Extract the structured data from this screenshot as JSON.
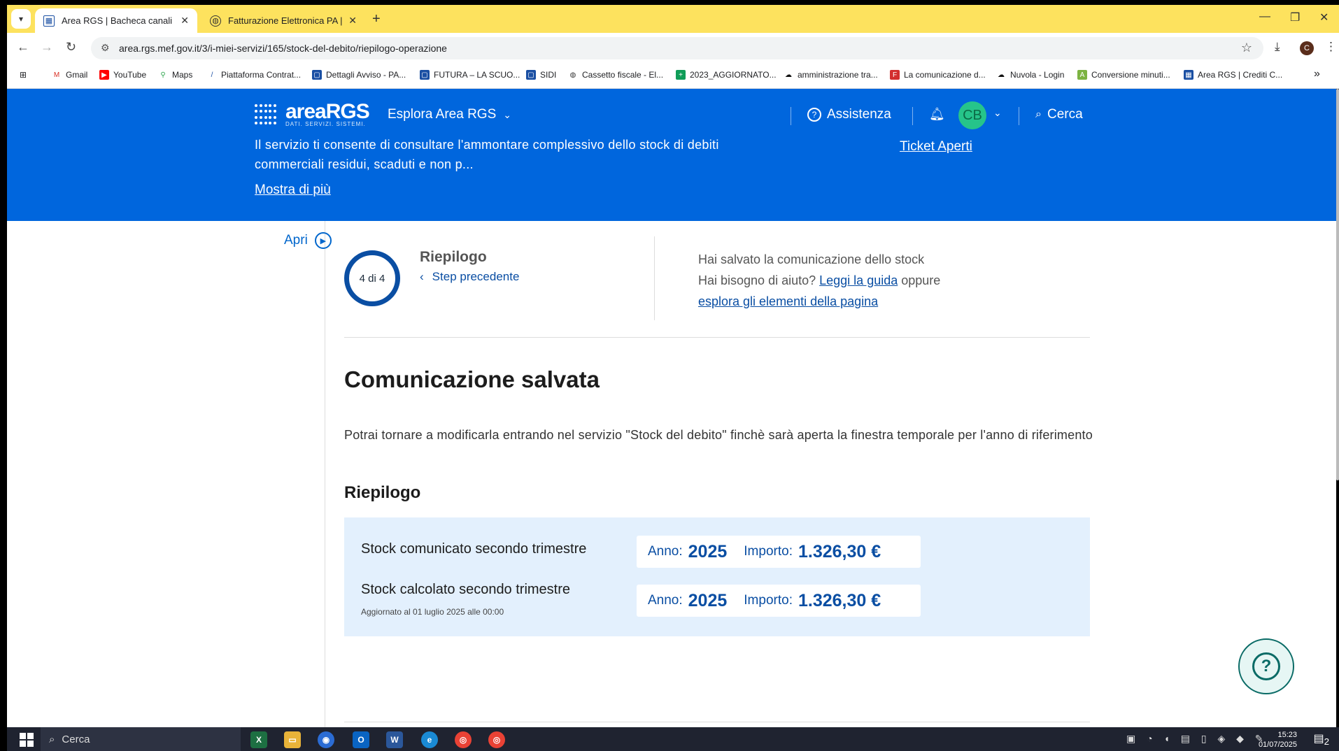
{
  "browser": {
    "tabs": [
      {
        "title": "Area RGS | Bacheca canali",
        "active": true
      },
      {
        "title": "Fatturazione Elettronica PA | Ge",
        "active": false
      }
    ],
    "new_tab": "+",
    "url": "area.rgs.mef.gov.it/3/i-miei-servizi/165/stock-del-debito/riepilogo-operazione",
    "profile_initial": "C",
    "bookmarks": [
      "Gmail",
      "YouTube",
      "Maps",
      "Piattaforma Contrat...",
      "Dettagli Avviso - PA...",
      "FUTURA – LA SCUO...",
      "SIDI",
      "Cassetto fiscale - El...",
      "2023_AGGIORNATO...",
      "amministrazione tra...",
      "La comunicazione d...",
      "Nuvola - Login",
      "Conversione minuti...",
      "Area RGS | Crediti C..."
    ],
    "more_bookmarks": "»"
  },
  "header": {
    "logo_text": "areaRGS",
    "logo_sub": "DATI. SERVIZI. SISTEMI.",
    "explore": "Esplora Area RGS",
    "assistance": "Assistenza",
    "user_initials": "CB",
    "search": "Cerca",
    "description": "Il servizio ti consente di consultare l'ammontare complessivo dello stock di debiti commerciali residui, scaduti e non p...",
    "show_more": "Mostra di più",
    "open_tickets": "Ticket Aperti",
    "accent": "#0066dd"
  },
  "sidebar": {
    "open_label": "Apri"
  },
  "stepper": {
    "counter": "4 di 4",
    "title": "Riepilogo",
    "prev": "Step precedente"
  },
  "help": {
    "line1": "Hai salvato la comunicazione dello stock",
    "line2_pre": "Hai bisogno di aiuto?",
    "guide_link": "Leggi la guida",
    "line2_post": "oppure",
    "explore_link": "esplora gli elementi della pagina"
  },
  "content": {
    "title": "Comunicazione salvata",
    "paragraph": "Potrai tornare a modificarla entrando nel servizio \"Stock del debito\" finchè sarà aperta la finestra temporale per l'anno di riferimento",
    "summary_title": "Riepilogo",
    "rows": [
      {
        "label": "Stock comunicato secondo trimestre",
        "sub": "",
        "year_key": "Anno:",
        "year": "2025",
        "amount_key": "Importo:",
        "amount": "1.326,30 €"
      },
      {
        "label": "Stock calcolato secondo trimestre",
        "sub": "Aggiornato al 01 luglio 2025 alle 00:00",
        "year_key": "Anno:",
        "year": "2025",
        "amount_key": "Importo:",
        "amount": "1.326,30 €"
      }
    ]
  },
  "taskbar": {
    "search": "Cerca",
    "time": "15:23",
    "date": "01/07/2025",
    "notifications": "2"
  }
}
